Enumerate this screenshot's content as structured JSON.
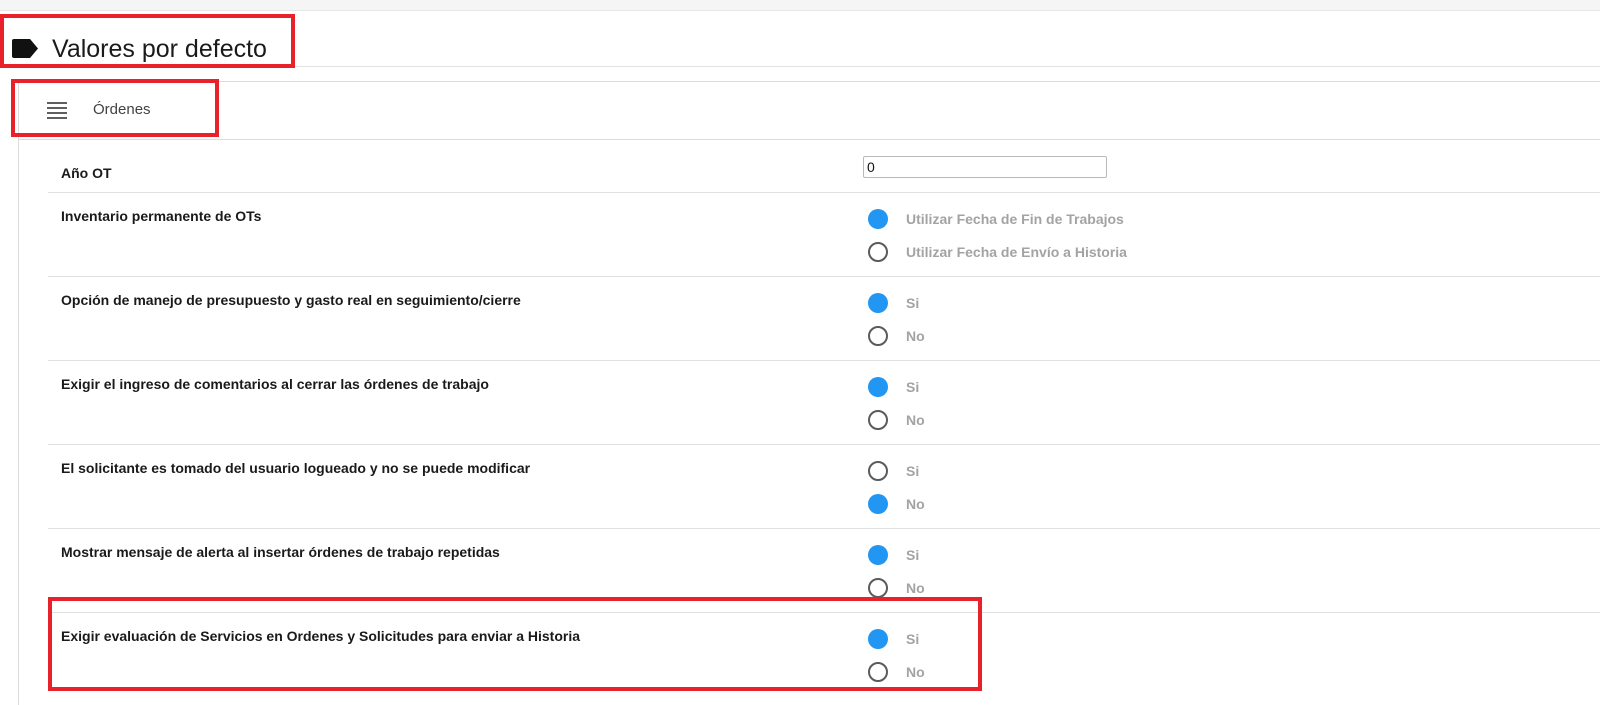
{
  "header": {
    "title": "Valores por defecto"
  },
  "section": {
    "label": "Órdenes"
  },
  "fields": {
    "ano_ot": {
      "label": "Año OT",
      "value": "0"
    },
    "inventario": {
      "label": "Inventario permanente de OTs",
      "options": [
        {
          "label": "Utilizar Fecha de Fin de Trabajos",
          "selected": true
        },
        {
          "label": "Utilizar Fecha de Envío a Historia",
          "selected": false
        }
      ]
    },
    "presupuesto": {
      "label": "Opción de manejo de presupuesto y gasto real en seguimiento/cierre",
      "options": [
        {
          "label": "Si",
          "selected": true
        },
        {
          "label": "No",
          "selected": false
        }
      ]
    },
    "comentarios": {
      "label": "Exigir el ingreso de comentarios al cerrar las órdenes de trabajo",
      "options": [
        {
          "label": "Si",
          "selected": true
        },
        {
          "label": "No",
          "selected": false
        }
      ]
    },
    "solicitante": {
      "label": "El solicitante es tomado del usuario logueado y no se puede modificar",
      "options": [
        {
          "label": "Si",
          "selected": false
        },
        {
          "label": "No",
          "selected": true
        }
      ]
    },
    "alerta": {
      "label": "Mostrar mensaje de alerta al insertar órdenes de trabajo repetidas",
      "options": [
        {
          "label": "Si",
          "selected": true
        },
        {
          "label": "No",
          "selected": false
        }
      ]
    },
    "evaluacion": {
      "label": "Exigir evaluación de Servicios en Ordenes y Solicitudes para enviar a Historia",
      "options": [
        {
          "label": "Si",
          "selected": true
        },
        {
          "label": "No",
          "selected": false
        }
      ]
    }
  },
  "colors": {
    "highlight": "#e8222b",
    "radio_selected": "#2196f3",
    "option_text": "#a3a3a3"
  }
}
